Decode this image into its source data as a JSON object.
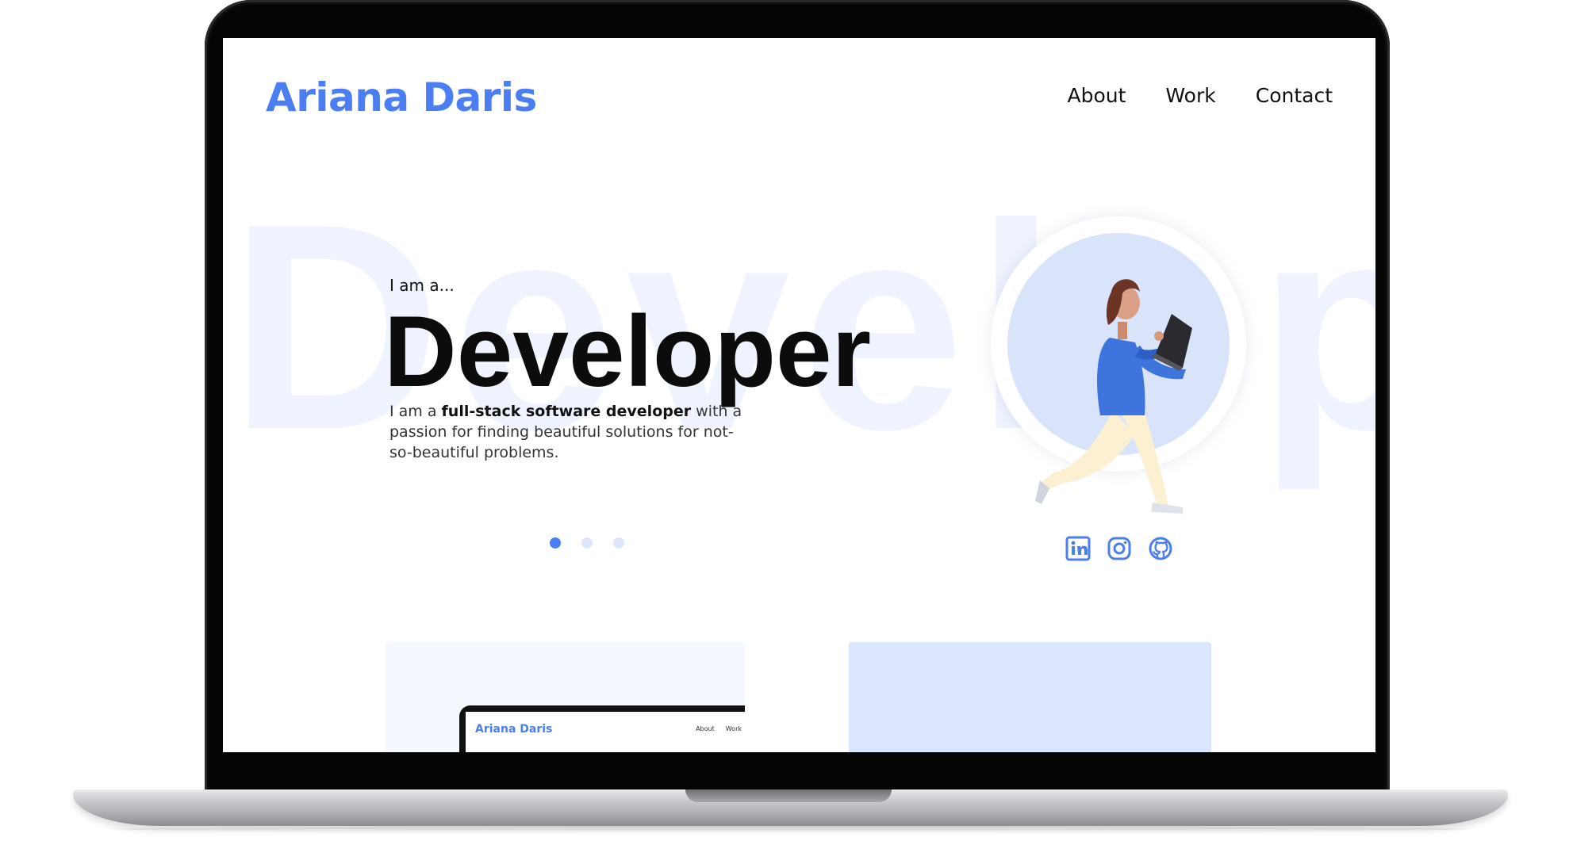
{
  "site": {
    "brand": "Ariana Daris",
    "nav": [
      "About",
      "Work",
      "Contact"
    ]
  },
  "hero": {
    "background_word": "Develop",
    "lede": "I am a...",
    "role": "Developer",
    "description": {
      "before": "I am a ",
      "bold": "full-stack software developer",
      "after": " with a passion for finding beautiful solutions for not-so-beautiful problems."
    },
    "carousel": {
      "count": 3,
      "active_index": 0
    }
  },
  "social_icons": [
    "linkedin-icon",
    "instagram-icon",
    "github-icon"
  ],
  "preview_card": {
    "brand": "Ariana Daris",
    "nav": [
      "About",
      "Work"
    ]
  },
  "colors": {
    "accent": "#4a7ef2",
    "accent_light": "#d9e4fb",
    "text": "#0c0c0c"
  }
}
